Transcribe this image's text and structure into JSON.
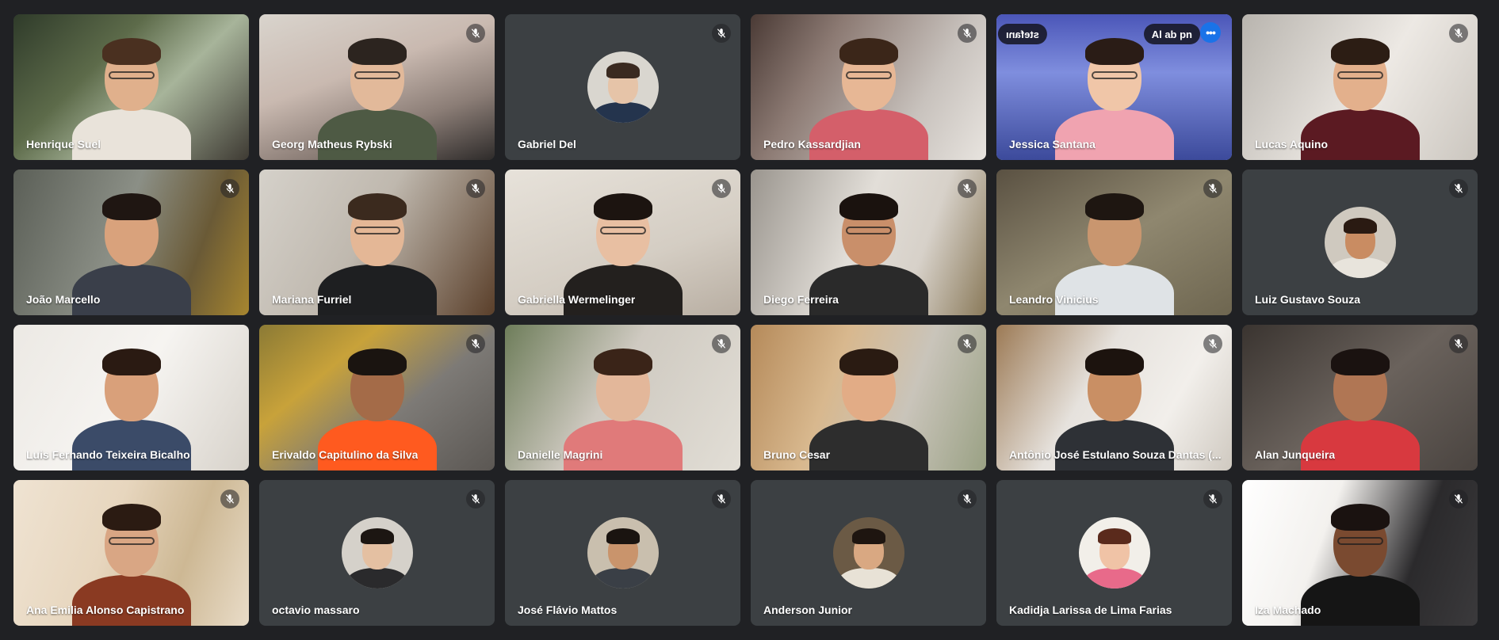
{
  "participants": [
    {
      "name": "Henrique Suel",
      "muted": false
    },
    {
      "name": "Georg Matheus Rybski",
      "muted": true
    },
    {
      "name": "Gabriel Del",
      "muted": true
    },
    {
      "name": "Pedro Kassardjian",
      "muted": true
    },
    {
      "name": "Jessica Santana",
      "muted": false,
      "speaking": true
    },
    {
      "name": "Lucas Aquino",
      "muted": true
    },
    {
      "name": "João Marcello",
      "muted": true
    },
    {
      "name": "Mariana Furriel",
      "muted": true
    },
    {
      "name": "Gabriella Wermelinger",
      "muted": true
    },
    {
      "name": "Diego Ferreira",
      "muted": true
    },
    {
      "name": "Leandro Vinicius",
      "muted": true
    },
    {
      "name": "Luiz Gustavo Souza",
      "muted": true
    },
    {
      "name": "Luis Fernando Teixeira Bicalho",
      "muted": false
    },
    {
      "name": "Erivaldo Capitulino da Silva",
      "muted": true
    },
    {
      "name": "Danielle Magrini",
      "muted": true
    },
    {
      "name": "Bruno Cesar",
      "muted": true
    },
    {
      "name": "Antônio José Estulano Souza Dantas (...",
      "muted": true
    },
    {
      "name": "Alan Junqueira",
      "muted": true
    },
    {
      "name": "Ana Emilia Alonso Capistrano",
      "muted": true
    },
    {
      "name": "octavio massaro",
      "muted": true
    },
    {
      "name": "José Flávio Mattos",
      "muted": true
    },
    {
      "name": "Anderson Junior",
      "muted": true
    },
    {
      "name": "Kadidja Larissa de Lima Farias",
      "muted": true
    },
    {
      "name": "Iza Machado",
      "muted": true
    }
  ],
  "jessica_tile": {
    "banner_left": "stefanı",
    "banner_right": "Al ab pn",
    "more_label": "•••"
  },
  "icons": {
    "mute": "mic-off-icon",
    "more": "more-options-icon"
  },
  "colors": {
    "page_bg": "#202124",
    "tile_bg": "#3c4043",
    "active_border": "#8ab4f8",
    "more_button": "#1a73e8"
  }
}
